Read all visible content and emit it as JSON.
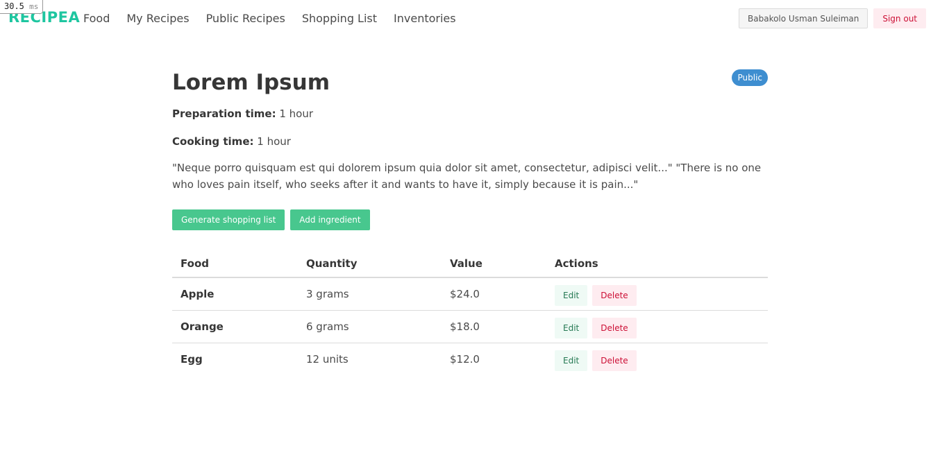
{
  "timer": {
    "value": "30.5",
    "unit": "ms"
  },
  "navbar": {
    "brand": "RECIPEA",
    "links": [
      "Food",
      "My Recipes",
      "Public Recipes",
      "Shopping List",
      "Inventories"
    ],
    "user_name": "Babakolo Usman Suleiman",
    "signout_label": "Sign out"
  },
  "recipe": {
    "title": "Lorem Ipsum",
    "visibility": "Public",
    "prep_label": "Preparation time:",
    "prep_value": "1 hour",
    "cook_label": "Cooking time:",
    "cook_value": "1 hour",
    "description": "\"Neque porro quisquam est qui dolorem ipsum quia dolor sit amet, consectetur, adipisci velit...\" \"There is no one who loves pain itself, who seeks after it and wants to have it, simply because it is pain...\""
  },
  "buttons": {
    "generate_label": "Generate shopping list",
    "add_label": "Add ingredient"
  },
  "table": {
    "headers": [
      "Food",
      "Quantity",
      "Value",
      "Actions"
    ],
    "rows": [
      {
        "food": "Apple",
        "quantity": "3 grams",
        "value": "$24.0",
        "edit": "Edit",
        "delete": "Delete"
      },
      {
        "food": "Orange",
        "quantity": "6 grams",
        "value": "$18.0",
        "edit": "Edit",
        "delete": "Delete"
      },
      {
        "food": "Egg",
        "quantity": "12 units",
        "value": "$12.0",
        "edit": "Edit",
        "delete": "Delete"
      }
    ]
  },
  "colors": {
    "brand": "#1ec6a0",
    "primary_green": "#48c78e",
    "info_blue": "#3e8ed0",
    "danger": "#cc0f35"
  }
}
